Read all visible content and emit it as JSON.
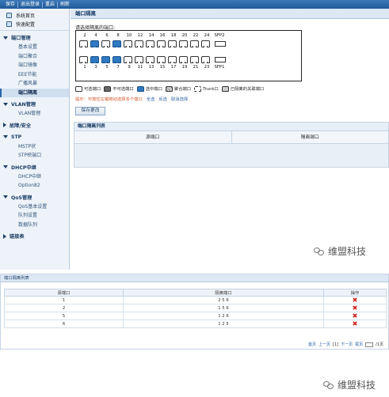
{
  "toolbar": {
    "items": [
      "保存",
      "退出登录",
      "重启",
      "刷新"
    ]
  },
  "sidebar": {
    "top_links": [
      {
        "label": "系统首页"
      },
      {
        "label": "快速配置"
      }
    ],
    "sections": [
      {
        "title": "端口管理",
        "expanded": true,
        "items": [
          "基本设置",
          "端口聚合",
          "端口镜像",
          "EEE节能",
          "广播风暴",
          "端口隔离"
        ],
        "active_index": 5
      },
      {
        "title": "VLAN管理",
        "expanded": true,
        "items": [
          "VLAN管理"
        ]
      },
      {
        "title": "故障/安全",
        "expanded": false,
        "items": []
      },
      {
        "title": "STP",
        "expanded": true,
        "items": [
          "MSTP状",
          "STP桥端口"
        ]
      },
      {
        "title": "DHCP中继",
        "expanded": true,
        "items": [
          "DHCP中继",
          "Option82"
        ]
      },
      {
        "title": "QoS管理",
        "expanded": true,
        "items": [
          "QoS基本设置",
          "队列设置",
          "数据队列"
        ]
      },
      {
        "title": "链接表",
        "expanded": false,
        "items": []
      }
    ]
  },
  "main": {
    "title": "端口隔离",
    "choose_label": "请选择隔离的端口:",
    "top_numbers": [
      "2",
      "4",
      "6",
      "8",
      "10",
      "12",
      "14",
      "16",
      "18",
      "20",
      "22",
      "24"
    ],
    "bottom_numbers": [
      "1",
      "3",
      "5",
      "7",
      "9",
      "11",
      "13",
      "15",
      "17",
      "19",
      "21",
      "23"
    ],
    "sfp_top": "SFP2",
    "sfp_bottom": "SFP1",
    "top_selected": [
      1,
      3
    ],
    "bottom_selected": [
      1,
      2,
      3
    ],
    "legend": [
      "可选端口",
      "不可选端口",
      "选中端口",
      "聚合端口",
      "Trunk口",
      "已隔离的关联端口"
    ],
    "hint_warning": "提示：可按住左键拖动选择多个端口",
    "hint_links": [
      "全选",
      "反选",
      "取消选择"
    ],
    "save_button": "保存更改",
    "list_title": "端口隔离列表",
    "list_columns": [
      "源端口",
      "隔离端口"
    ]
  },
  "lower": {
    "title": "端口隔离列表",
    "columns": [
      "源端口",
      "隔离端口",
      "操作"
    ],
    "rows": [
      {
        "src": "1",
        "iso": "2 5 6"
      },
      {
        "src": "2",
        "iso": "1 5 6"
      },
      {
        "src": "5",
        "iso": "1 2 6"
      },
      {
        "src": "6",
        "iso": "1 2 5"
      }
    ],
    "pager": {
      "first": "首页",
      "prev": "上一页",
      "page": "[1]",
      "next": "下一页",
      "last": "尾页",
      "total": "/1页"
    }
  },
  "watermark": "维盟科技",
  "colors": {
    "selected_port": "#2e79c2",
    "header_bg": "#dde8f4",
    "delete": "#d02020"
  }
}
